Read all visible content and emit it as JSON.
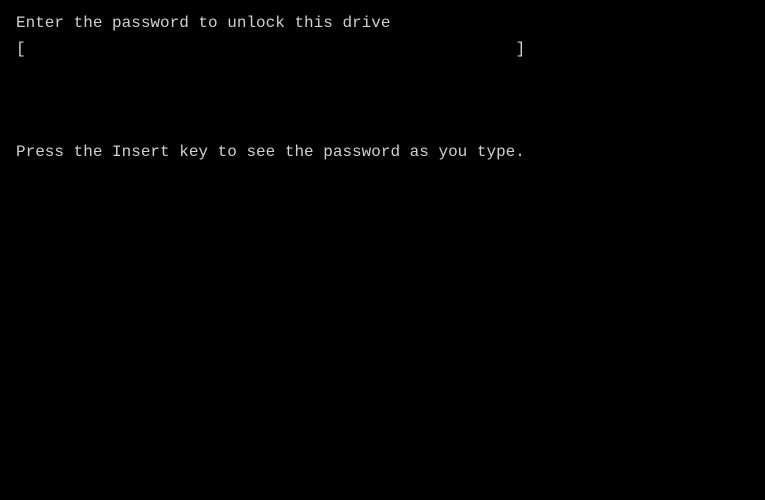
{
  "terminal": {
    "prompt_text": "Enter the password to unlock this drive",
    "bracket_left": "[",
    "bracket_right": "]",
    "input_value": "",
    "input_placeholder": "",
    "hint_text": "Press the Insert key to see the password as you type."
  }
}
